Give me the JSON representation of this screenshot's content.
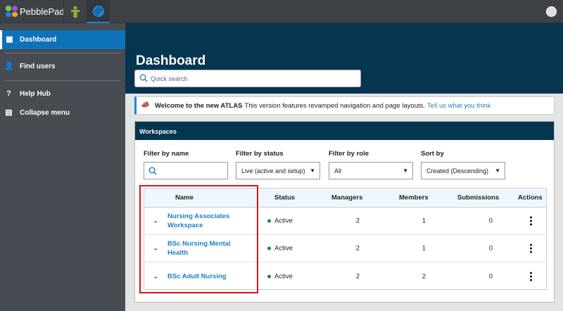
{
  "topbar": {
    "brand": "PebblePad",
    "tabs": [
      {
        "icon": "person-figure-icon"
      },
      {
        "icon": "atlas-globe-icon",
        "active": true
      }
    ],
    "avatar_icon": "user-avatar-icon"
  },
  "sidebar": {
    "items": [
      {
        "label": "Dashboard",
        "icon": "dashboard-icon",
        "active": true
      },
      {
        "label": "Find users",
        "icon": "user-icon"
      },
      {
        "label": "Help Hub",
        "icon": "help-icon"
      },
      {
        "label": "Collapse menu",
        "icon": "collapse-menu-icon"
      }
    ]
  },
  "page": {
    "title": "Dashboard",
    "search_placeholder": "Quick search"
  },
  "banner": {
    "bold": "Welcome to the new ATLAS",
    "text": "This version features revamped navigation and page layouts.",
    "link": "Tell us what you think"
  },
  "workspaces": {
    "title": "Workspaces",
    "filters": {
      "name_label": "Filter by name",
      "name_value": "",
      "status_label": "Filter by status",
      "status_value": "Live (active and setup)",
      "role_label": "Filter by role",
      "role_value": "All",
      "sort_label": "Sort by",
      "sort_value": "Created (Descending)"
    },
    "columns": [
      "Name",
      "Status",
      "Managers",
      "Members",
      "Submissions",
      "Actions"
    ],
    "rows": [
      {
        "name": "Nursing Associates Workspace",
        "status": "Active",
        "managers": "2",
        "members": "1",
        "submissions": "0"
      },
      {
        "name": "BSc Nursing Mental Health",
        "status": "Active",
        "managers": "2",
        "members": "1",
        "submissions": "0"
      },
      {
        "name": "BSc Adult Nursing",
        "status": "Active",
        "managers": "2",
        "members": "2",
        "submissions": "0"
      }
    ]
  },
  "colors": {
    "navy": "#063550",
    "accent": "#0e72b8",
    "link": "#1e7fc4",
    "active_status": "#1a8a3a",
    "highlight": "#e01010"
  }
}
